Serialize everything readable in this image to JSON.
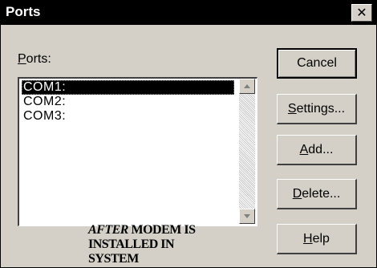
{
  "window": {
    "title": "Ports",
    "close_glyph": "✕"
  },
  "ports_label": {
    "mnemonic": "P",
    "rest": "orts:"
  },
  "ports_list": {
    "items": [
      "COM1:",
      "COM2:",
      "COM3:"
    ],
    "selected_index": 0
  },
  "annotation": {
    "emphasis": "AFTER",
    "line1_rest": " MODEM IS",
    "line2": "INSTALLED IN",
    "line3": "SYSTEM"
  },
  "buttons": {
    "cancel": "Cancel",
    "settings": {
      "mnemonic": "S",
      "rest": "ettings..."
    },
    "add": {
      "mnemonic": "A",
      "rest": "dd..."
    },
    "delete": {
      "mnemonic": "D",
      "rest": "elete..."
    },
    "help": {
      "mnemonic": "H",
      "rest": "elp"
    }
  },
  "icons": {
    "close": "close-icon",
    "scroll_up": "scroll-up-arrow-icon",
    "scroll_down": "scroll-down-arrow-icon"
  },
  "colors": {
    "dialog_face": "#d4d0c8",
    "title_bar": "#000000",
    "selection": "#000000"
  }
}
